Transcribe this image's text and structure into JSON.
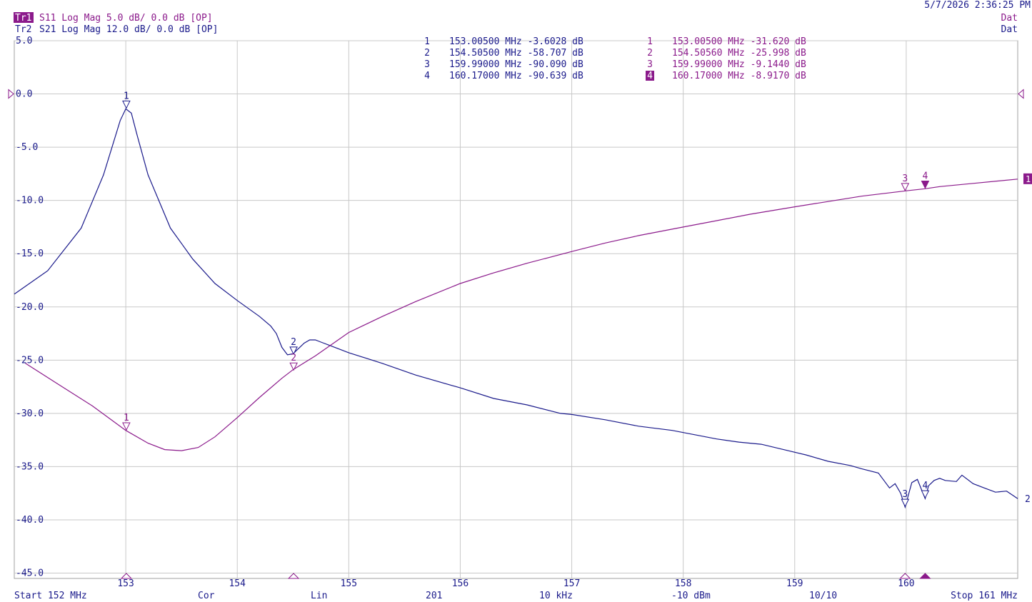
{
  "timestamp": "5/7/2026 2:36:25 PM",
  "traces": [
    {
      "id": "Tr1",
      "label": "S11 Log Mag 5.0 dB/ 0.0 dB [OP]",
      "status": "Dat",
      "color": "#8b1a8b"
    },
    {
      "id": "Tr2",
      "label": "S21 Log Mag 12.0 dB/ 0.0 dB [OP]",
      "status": "Dat",
      "color": "#1a1a8b"
    }
  ],
  "marker_tables": [
    {
      "trace": "Tr2",
      "color": "#1a1a8b",
      "rows": [
        {
          "n": "1",
          "text": "153.00500 MHz -3.6028 dB"
        },
        {
          "n": "2",
          "text": "154.50500 MHz -58.707 dB"
        },
        {
          "n": "3",
          "text": "159.99000 MHz -90.090 dB"
        },
        {
          "n": "4",
          "text": "160.17000 MHz -90.639 dB"
        }
      ]
    },
    {
      "trace": "Tr1",
      "color": "#8b1a8b",
      "active_marker": "4",
      "rows": [
        {
          "n": "1",
          "text": "153.00500 MHz -31.620 dB"
        },
        {
          "n": "2",
          "text": "154.50560 MHz -25.998 dB"
        },
        {
          "n": "3",
          "text": "159.99000 MHz -9.1440 dB"
        },
        {
          "n": "4",
          "text": "160.17000 MHz -8.9170 dB"
        }
      ]
    }
  ],
  "footer": {
    "start": "Start 152 MHz",
    "cor": "Cor",
    "sweep": "Lin",
    "points": "201",
    "ifbw": "10 kHz",
    "power": "-10 dBm",
    "avg": "10/10",
    "stop": "Stop 161 MHz"
  },
  "chart_data": {
    "type": "line",
    "xlim": [
      152,
      161
    ],
    "ylim": [
      -45.5,
      5
    ],
    "grid": true,
    "y_ticks": [
      5,
      0,
      -5,
      -10,
      -15,
      -20,
      -25,
      -30,
      -35,
      -40,
      -45
    ],
    "y_tick_labels": [
      "5.0",
      "0.0",
      "-5.0",
      "-10.0",
      "-15.0",
      "-20.0",
      "-25.0",
      "-30.0",
      "-35.0",
      "-40.0",
      "-45.0"
    ],
    "x_ticks": [
      153,
      154,
      155,
      156,
      157,
      158,
      159,
      160
    ],
    "x_tick_labels": [
      "153",
      "154",
      "155",
      "156",
      "157",
      "158",
      "159",
      "160"
    ],
    "series": [
      {
        "name": "Tr2 S21",
        "end_label": "2",
        "color": "#1a1a8b",
        "x": [
          152.0,
          152.3,
          152.6,
          152.8,
          152.9,
          152.95,
          153.0,
          153.05,
          153.1,
          153.2,
          153.4,
          153.6,
          153.8,
          154.0,
          154.2,
          154.3,
          154.35,
          154.4,
          154.45,
          154.5,
          154.55,
          154.6,
          154.65,
          154.7,
          154.75,
          154.85,
          155.0,
          155.3,
          155.6,
          156.0,
          156.3,
          156.6,
          156.9,
          157.0,
          157.3,
          157.6,
          157.9,
          158.1,
          158.3,
          158.5,
          158.7,
          158.9,
          159.1,
          159.3,
          159.5,
          159.6,
          159.75,
          159.8,
          159.85,
          159.9,
          159.95,
          159.99,
          160.05,
          160.1,
          160.17,
          160.2,
          160.25,
          160.3,
          160.35,
          160.45,
          160.5,
          160.6,
          160.7,
          160.8,
          160.9,
          161.0
        ],
        "y": [
          -18.8,
          -16.6,
          -12.6,
          -7.6,
          -4.2,
          -2.5,
          -1.4,
          -1.8,
          -3.8,
          -7.6,
          -12.6,
          -15.5,
          -17.8,
          -19.4,
          -20.9,
          -21.8,
          -22.5,
          -23.8,
          -24.5,
          -24.4,
          -23.9,
          -23.4,
          -23.1,
          -23.1,
          -23.3,
          -23.7,
          -24.3,
          -25.3,
          -26.4,
          -27.6,
          -28.6,
          -29.2,
          -30.0,
          -30.1,
          -30.6,
          -31.2,
          -31.6,
          -32.0,
          -32.4,
          -32.7,
          -32.9,
          -33.4,
          -33.9,
          -34.5,
          -34.9,
          -35.2,
          -35.6,
          -36.3,
          -37.0,
          -36.6,
          -37.5,
          -38.8,
          -36.5,
          -36.2,
          -38.0,
          -36.8,
          -36.3,
          -36.1,
          -36.3,
          -36.4,
          -35.8,
          -36.6,
          -37.0,
          -37.4,
          -37.3,
          -38.0
        ]
      },
      {
        "name": "Tr1 S11",
        "end_label": "1",
        "color": "#8b1a8b",
        "x": [
          152.1,
          152.4,
          152.7,
          153.0,
          153.2,
          153.35,
          153.5,
          153.65,
          153.8,
          154.0,
          154.2,
          154.4,
          154.5,
          154.7,
          155.0,
          155.3,
          155.6,
          156.0,
          156.3,
          156.6,
          157.0,
          157.3,
          157.6,
          158.0,
          158.3,
          158.6,
          159.0,
          159.3,
          159.6,
          160.0,
          160.17,
          160.3,
          160.6,
          161.0
        ],
        "y": [
          -25.3,
          -27.3,
          -29.3,
          -31.6,
          -32.8,
          -33.4,
          -33.5,
          -33.2,
          -32.2,
          -30.4,
          -28.5,
          -26.7,
          -25.9,
          -24.6,
          -22.4,
          -20.9,
          -19.5,
          -17.8,
          -16.8,
          -15.9,
          -14.8,
          -14.0,
          -13.3,
          -12.5,
          -11.9,
          -11.3,
          -10.6,
          -10.1,
          -9.6,
          -9.1,
          -8.9,
          -8.7,
          -8.4,
          -8.0
        ]
      }
    ],
    "markers": [
      {
        "series": "Tr2 S21",
        "label": "1",
        "x": 153.005,
        "y": -1.4,
        "style": "open"
      },
      {
        "series": "Tr2 S21",
        "label": "2",
        "x": 154.505,
        "y": -24.5,
        "style": "open"
      },
      {
        "series": "Tr2 S21",
        "label": "3",
        "x": 159.99,
        "y": -38.8,
        "style": "open"
      },
      {
        "series": "Tr2 S21",
        "label": "4",
        "x": 160.17,
        "y": -38.0,
        "style": "open"
      },
      {
        "series": "Tr1 S11",
        "label": "1",
        "x": 153.005,
        "y": -31.62,
        "style": "open"
      },
      {
        "series": "Tr1 S11",
        "label": "2",
        "x": 154.5056,
        "y": -26.0,
        "style": "open"
      },
      {
        "series": "Tr1 S11",
        "label": "3",
        "x": 159.99,
        "y": -9.14,
        "style": "open"
      },
      {
        "series": "Tr1 S11",
        "label": "4",
        "x": 160.17,
        "y": -8.92,
        "style": "filled"
      }
    ],
    "bottom_markers": [
      {
        "x": 153.005,
        "style": "open"
      },
      {
        "x": 154.505,
        "style": "open"
      },
      {
        "x": 159.99,
        "style": "open"
      },
      {
        "x": 160.17,
        "style": "filled"
      }
    ],
    "reference_level": 0
  }
}
